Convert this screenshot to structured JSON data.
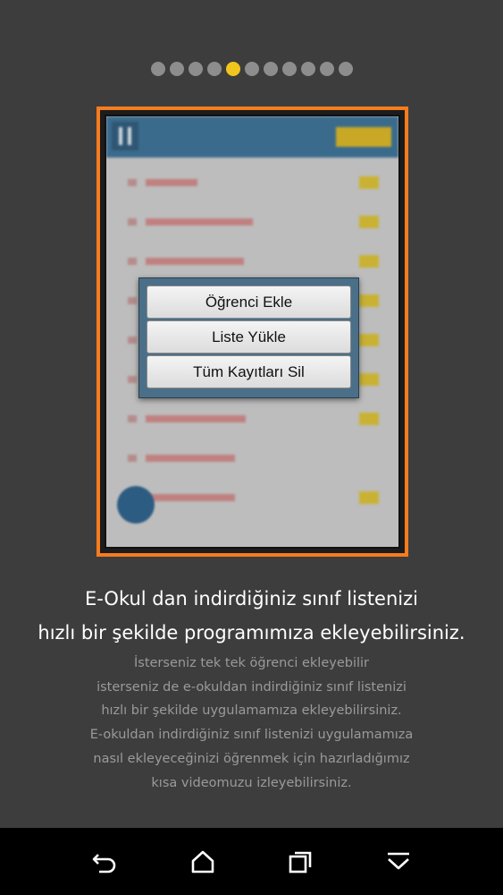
{
  "pager": {
    "total": 11,
    "active_index": 4,
    "active_color": "#f2c51d",
    "inactive_color": "#8d8d8d"
  },
  "preview": {
    "frame_color": "#f57c1f",
    "dialog": {
      "options": [
        "Öğrenci Ekle",
        "Liste Yükle",
        "Tüm Kayıtları Sil"
      ]
    }
  },
  "headline": {
    "line1": "E-Okul dan indirdiğiniz sınıf listenizi",
    "line2": "hızlı bir şekilde programımıza ekleyebilirsiniz."
  },
  "description": {
    "lines": [
      "İsterseniz tek tek öğrenci ekleyebilir",
      "isterseniz de e-okuldan indirdiğiniz sınıf listenizi",
      "hızlı bir şekilde uygulamamıza ekleyebilirsiniz.",
      "E-okuldan indirdiğiniz sınıf listenizi uygulamamıza",
      "nasıl ekleyeceğinizi öğrenmek için hazırladığımız",
      "kısa videomuzu izleyebilirsiniz."
    ]
  },
  "navbar": {
    "buttons": [
      "back-icon",
      "home-icon",
      "recents-icon",
      "hide-keyboard-icon"
    ]
  }
}
